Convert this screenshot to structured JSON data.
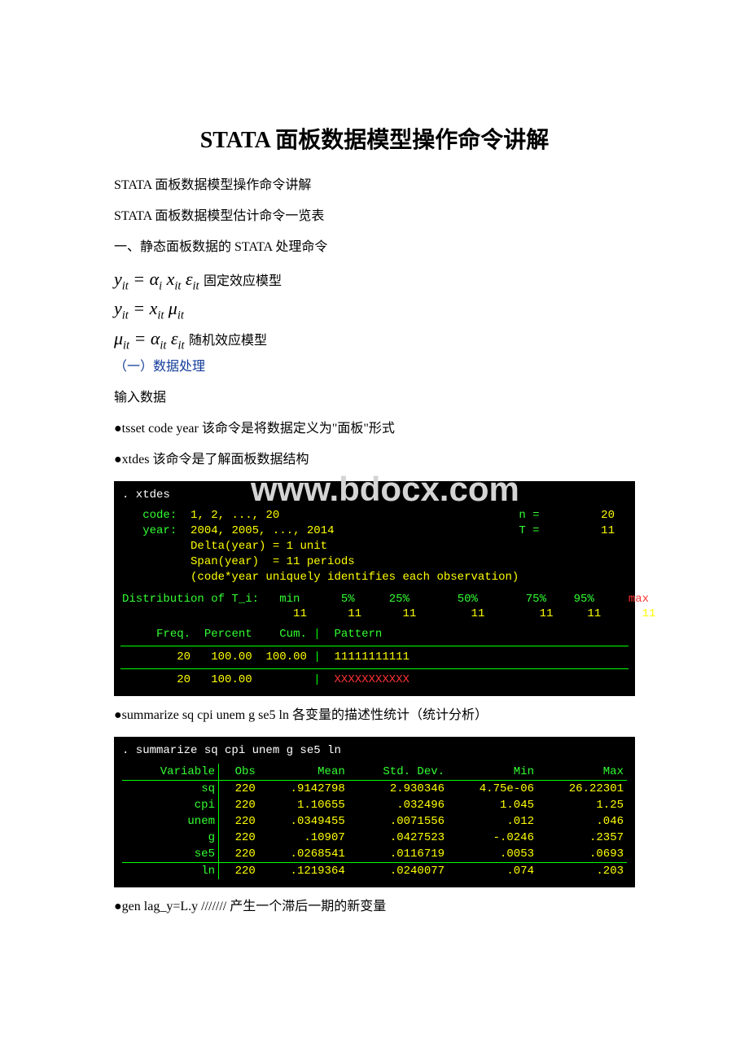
{
  "title": "STATA 面板数据模型操作命令讲解",
  "lines": {
    "l1": "STATA 面板数据模型操作命令讲解",
    "l2": "STATA 面板数据模型估计命令一览表",
    "l3": "一、静态面板数据的 STATA 处理命令",
    "fixed": "固定效应模型",
    "random": "随机效应模型",
    "sec1": "（一）数据处理",
    "l4": "输入数据",
    "l5": "●tsset code year 该命令是将数据定义为\"面板\"形式",
    "l6": "●xtdes 该命令是了解面板数据结构",
    "l7": "●summarize sq cpi unem g se5 ln 各变量的描述性统计（统计分析）",
    "l8": "●gen lag_y=L.y /////// 产生一个滞后一期的新变量"
  },
  "watermark": "www.bdocx.com",
  "xtdes": {
    "cmd": ". xtdes",
    "code_lbl": "code:",
    "code_val": "1, 2, ..., 20",
    "n_lbl": "n =",
    "n_val": "20",
    "year_lbl": "year:",
    "year_val": "2004, 2005, ..., 2014",
    "t_lbl": "T =",
    "t_val": "11",
    "delta": "Delta(year) = 1 unit",
    "span": "Span(year)  = 11 periods",
    "note": "(code*year uniquely identifies each observation)",
    "dist_lbl": "Distribution of T_i:",
    "dist_hdr": [
      "min",
      "5%",
      "25%",
      "50%",
      "75%",
      "95%",
      "max"
    ],
    "dist_val": [
      "11",
      "11",
      "11",
      "11",
      "11",
      "11",
      "11"
    ],
    "freq_hdr": [
      "Freq.",
      "Percent",
      "Cum.",
      "Pattern"
    ],
    "freq_row": [
      "20",
      "100.00",
      "100.00",
      "11111111111"
    ],
    "total_row": [
      "20",
      "100.00",
      "",
      "XXXXXXXXXXX"
    ]
  },
  "summarize": {
    "cmd": ". summarize sq cpi unem g se5 ln",
    "headers": [
      "Variable",
      "Obs",
      "Mean",
      "Std. Dev.",
      "Min",
      "Max"
    ],
    "rows": [
      {
        "var": "sq",
        "obs": "220",
        "mean": ".9142798",
        "sd": "2.930346",
        "min": "4.75e-06",
        "max": "26.22301"
      },
      {
        "var": "cpi",
        "obs": "220",
        "mean": "1.10655",
        "sd": ".032496",
        "min": "1.045",
        "max": "1.25"
      },
      {
        "var": "unem",
        "obs": "220",
        "mean": ".0349455",
        "sd": ".0071556",
        "min": ".012",
        "max": ".046"
      },
      {
        "var": "g",
        "obs": "220",
        "mean": ".10907",
        "sd": ".0427523",
        "min": "-.0246",
        "max": ".2357"
      },
      {
        "var": "se5",
        "obs": "220",
        "mean": ".0268541",
        "sd": ".0116719",
        "min": ".0053",
        "max": ".0693"
      }
    ],
    "row_ln": {
      "var": "ln",
      "obs": "220",
      "mean": ".1219364",
      "sd": ".0240077",
      "min": ".074",
      "max": ".203"
    }
  }
}
